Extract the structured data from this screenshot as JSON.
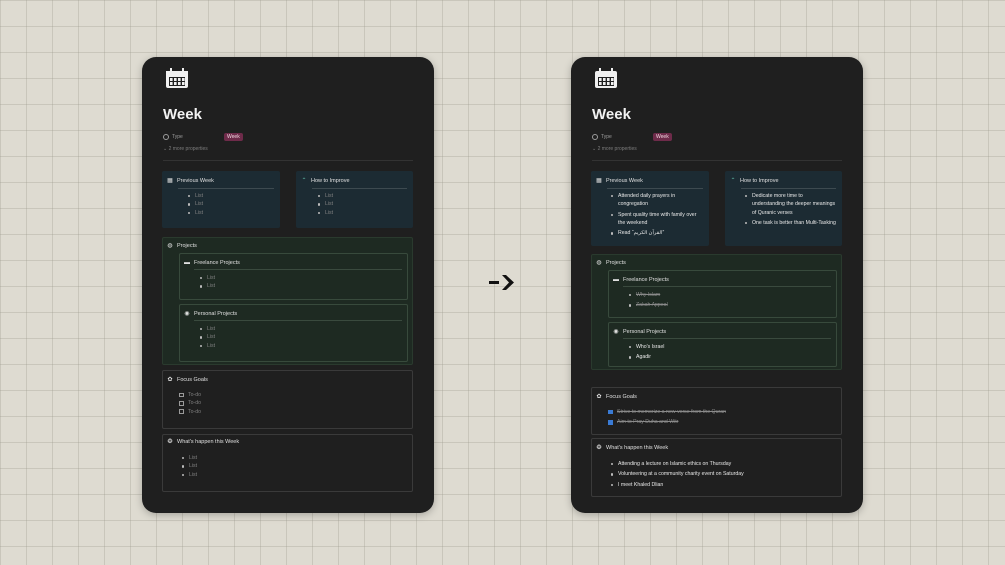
{
  "left": {
    "title": "Week",
    "type_label": "Type",
    "type_badge": "Week",
    "more_properties": "2 more properties",
    "previous_week": {
      "title": "Previous Week",
      "items": [
        "List",
        "List",
        "List"
      ]
    },
    "how_to_improve": {
      "title": "How to Improve",
      "items": [
        "List",
        "List",
        "List"
      ]
    },
    "projects": {
      "title": "Projects",
      "freelance": {
        "title": "Freelance Projects",
        "items": [
          "List",
          "List"
        ]
      },
      "personal": {
        "title": "Personal Projects",
        "items": [
          "List",
          "List",
          "List"
        ]
      }
    },
    "focus_goals": {
      "title": "Focus Goals",
      "items": [
        "To-do",
        "To-do",
        "To-do"
      ]
    },
    "whats_happen": {
      "title": "What's happen this Week",
      "items": [
        "List",
        "List",
        "List"
      ]
    }
  },
  "right": {
    "title": "Week",
    "type_label": "Type",
    "type_badge": "Week",
    "more_properties": "2 more properties",
    "previous_week": {
      "title": "Previous Week",
      "items": [
        "Attended daily prayers in congregation",
        "Spent quality time with family over the weekend",
        "Read “القرآن الكريم”"
      ]
    },
    "how_to_improve": {
      "title": "How to Improve",
      "items": [
        "Dedicate more time to understanding the deeper meanings of Quranic verses",
        "One task is better than Multi-Tasking"
      ]
    },
    "projects": {
      "title": "Projects",
      "freelance": {
        "title": "Freelance Projects",
        "items": [
          "Why Islam",
          "Zakah Appeal"
        ]
      },
      "personal": {
        "title": "Personal Projects",
        "items": [
          "Who's Israel",
          "Agadir"
        ]
      }
    },
    "focus_goals": {
      "title": "Focus Goals",
      "items": [
        "Strive to memorize a new verse from the Quran",
        "Aim to Pray Duha and Witr"
      ]
    },
    "whats_happen": {
      "title": "What's happen this Week",
      "items": [
        "Attending a lecture on Islamic ethics on Thursday",
        "Volunteering at a community charity event on Saturday",
        "I meet Khaled Dlian"
      ]
    }
  },
  "colors": {
    "card": "#1f1f1f",
    "badge": "#6e2b4a",
    "blue_callout": "#1c2b33",
    "green_callout": "#1e2a22",
    "checkbox_checked": "#3a7bd5"
  }
}
